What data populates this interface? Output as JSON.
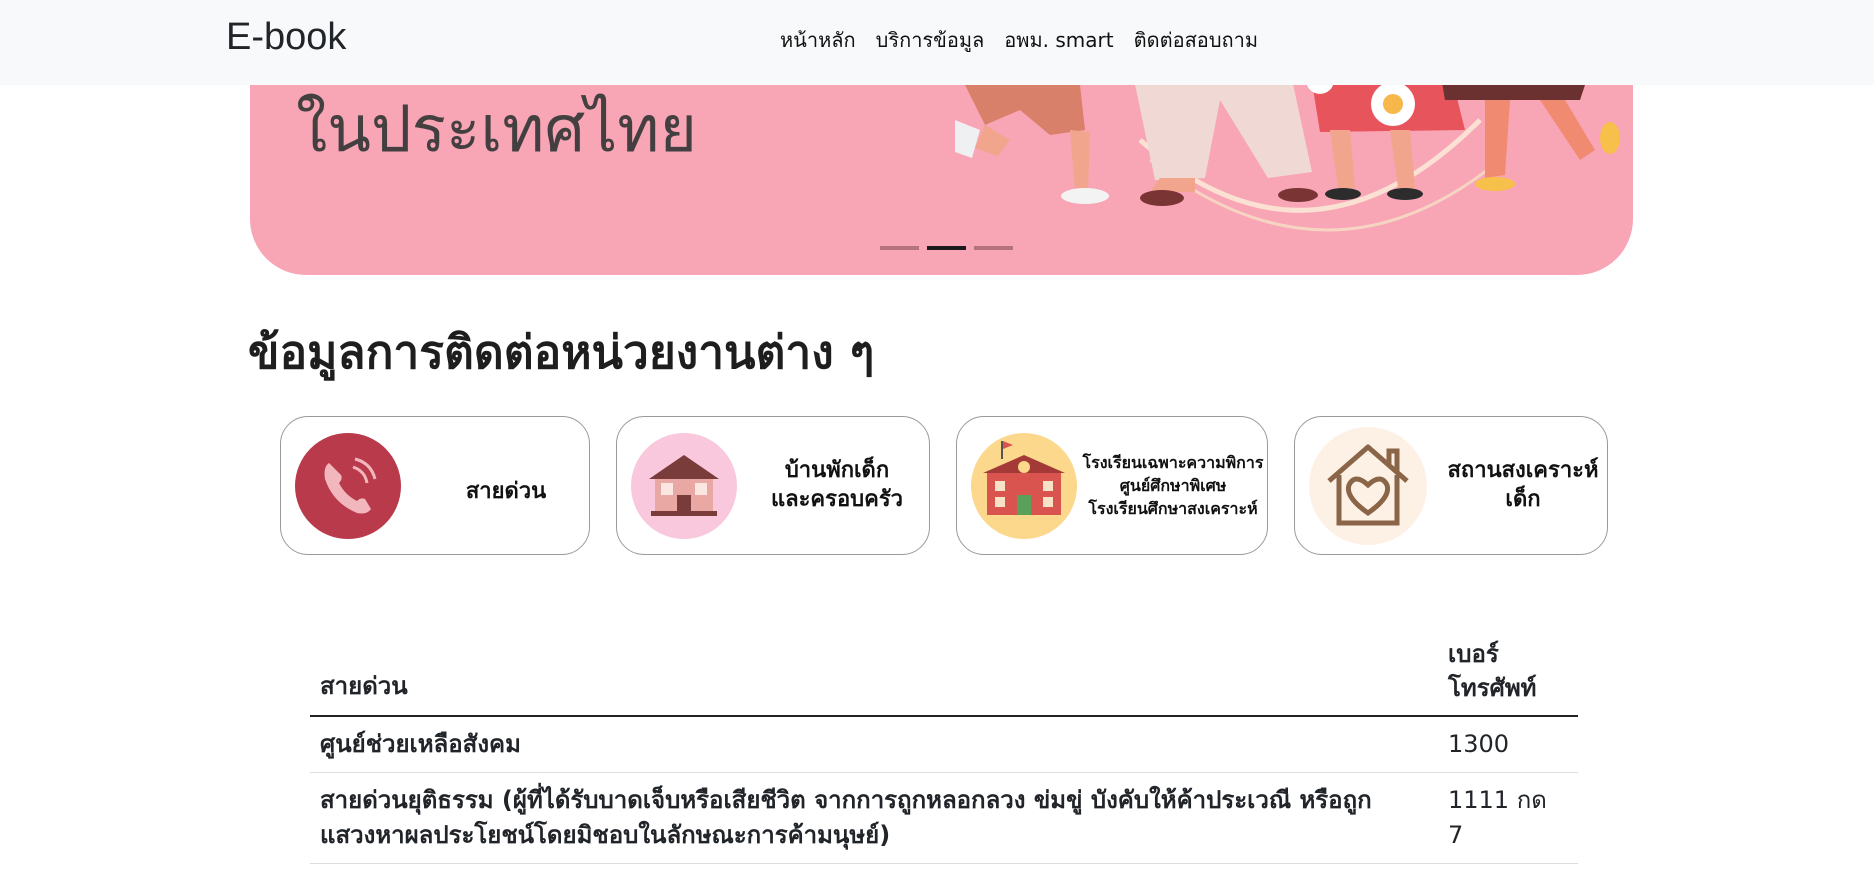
{
  "navbar": {
    "brand": "E-book",
    "links": [
      "หน้าหลัก",
      "บริการข้อมูล",
      "อพม. smart",
      "ติดต่อสอบถาม"
    ]
  },
  "banner": {
    "text": "ในประเทศไทย",
    "indicator_count": 3,
    "active_indicator": 2
  },
  "section": {
    "title": "ข้อมูลการติดต่อหน่วยงานต่าง ๆ"
  },
  "categories": [
    {
      "label": "สายด่วน",
      "icon": "phone-icon",
      "color": "#b83a4b"
    },
    {
      "label_line1": "บ้านพักเด็ก",
      "label_line2": "และครอบครัว",
      "icon": "house-icon",
      "color": "#f9c8dc"
    },
    {
      "label_line1": "โรงเรียนเฉพาะความพิการ",
      "label_line2": "ศูนย์ศึกษาพิเศษ",
      "label_line3": "โรงเรียนศึกษาสงเคราะห์",
      "icon": "school-icon",
      "color": "#fcd88d"
    },
    {
      "label_line1": "สถานสงเคราะห์",
      "label_line2": "เด็ก",
      "icon": "heart-house-icon",
      "color": "#fdf1e6"
    }
  ],
  "table": {
    "headers": {
      "name": "สายด่วน",
      "phone_line1": "เบอร์",
      "phone_line2": "โทรศัพท์"
    },
    "rows": [
      {
        "name": "ศูนย์ช่วยเหลือสังคม",
        "phone": "1300"
      },
      {
        "name": "สายด่วนยุติธรรม (ผู้ที่ได้รับบาดเจ็บหรือเสียชีวิต จากการถูกหลอกลวง ข่มขู่ บังคับให้ค้าประเวณี หรือถูกแสวงหาผลประโยชน์โดยมิชอบในลักษณะการค้ามนุษย์)",
        "phone": "1111 กด 7"
      }
    ]
  }
}
